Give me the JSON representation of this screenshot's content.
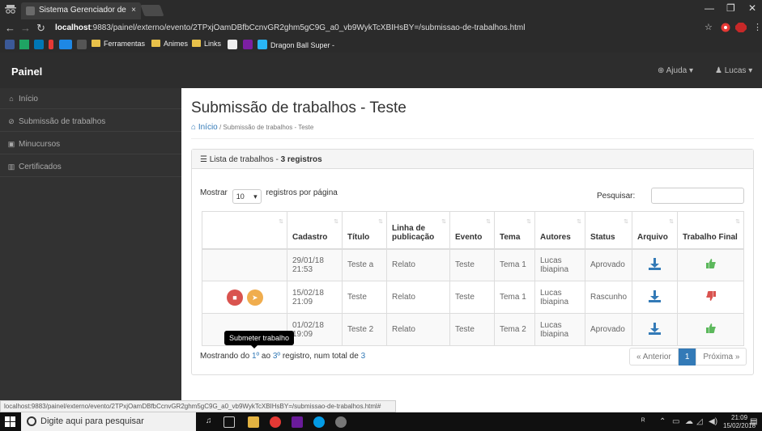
{
  "browser": {
    "tab_title": "Sistema Gerenciador de",
    "tab_close": "×",
    "window_controls": {
      "minimize": "—",
      "maximize": "❐",
      "close": "✕"
    },
    "url_host": "localhost",
    "url_rest": ":9883/painel/externo/evento/2TPxjOamDBfbCcnvGR2ghm5gC9G_a0_vb9WykTcXBIHsBY=/submissao-de-trabalhos.html",
    "bookmarks": [
      "Ferramentas",
      "Animes",
      "Links",
      "Dragon Ball Super -"
    ]
  },
  "navbar": {
    "brand": "Painel",
    "help": "Ajuda",
    "user": "Lucas"
  },
  "sidebar": {
    "items": [
      {
        "label": "Início"
      },
      {
        "label": "Submissão de trabalhos"
      },
      {
        "label": "Minucursos"
      },
      {
        "label": "Certificados"
      }
    ]
  },
  "page": {
    "title": "Submissão de trabalhos - Teste",
    "breadcrumb_home": "Início",
    "breadcrumb_current": "Submissão de trabalhos - Teste"
  },
  "panel": {
    "heading_prefix": "Lista de trabalhos - ",
    "heading_count": "3 registros",
    "show_label": "Mostrar",
    "page_length": "10",
    "per_page_label": "registros por página",
    "search_label": "Pesquisar:"
  },
  "table": {
    "headers": [
      "",
      "Cadastro",
      "Título",
      "Linha de publicação",
      "Evento",
      "Tema",
      "Autores",
      "Status",
      "Arquivo",
      "Trabalho Final"
    ],
    "rows": [
      {
        "cadastro": "29/01/18 21:53",
        "titulo": "Teste a",
        "linha": "Relato",
        "evento": "Teste",
        "tema": "Tema 1",
        "autores": "Lucas Ibiapina",
        "status": "Aprovado",
        "final": "thumbs-up"
      },
      {
        "cadastro": "15/02/18 21:09",
        "titulo": "Teste",
        "linha": "Relato",
        "evento": "Teste",
        "tema": "Tema 1",
        "autores": "Lucas Ibiapina",
        "status": "Rascunho",
        "final": "thumbs-down"
      },
      {
        "cadastro": "01/02/18 19:09",
        "titulo": "Teste 2",
        "linha": "Relato",
        "evento": "Teste",
        "tema": "Tema 2",
        "autores": "Lucas Ibiapina",
        "status": "Aprovado",
        "final": "thumbs-up"
      }
    ],
    "tooltip": "Submeter trabalho"
  },
  "footer": {
    "info_prefix": "Mostrando do ",
    "info_from": "1º",
    "info_mid": " ao ",
    "info_to": "3º",
    "info_mid2": " registro, num total de ",
    "info_total": "3",
    "prev": "« Anterior",
    "page": "1",
    "next": "Próxima »"
  },
  "status_url": "localhost:9883/painel/externo/evento/2TPxjOamDBfbCcnvGR2ghm5gC9G_a0_vb9WykTcXBIHsBY=/submissao-de-trabalhos.html#",
  "taskbar": {
    "search_placeholder": "Digite aqui para pesquisar",
    "time": "21:09",
    "date": "15/02/2018"
  },
  "colors": {
    "accent": "#337ab7",
    "danger": "#d9534f",
    "warning": "#f0ad4e",
    "success": "#5cb85c"
  }
}
